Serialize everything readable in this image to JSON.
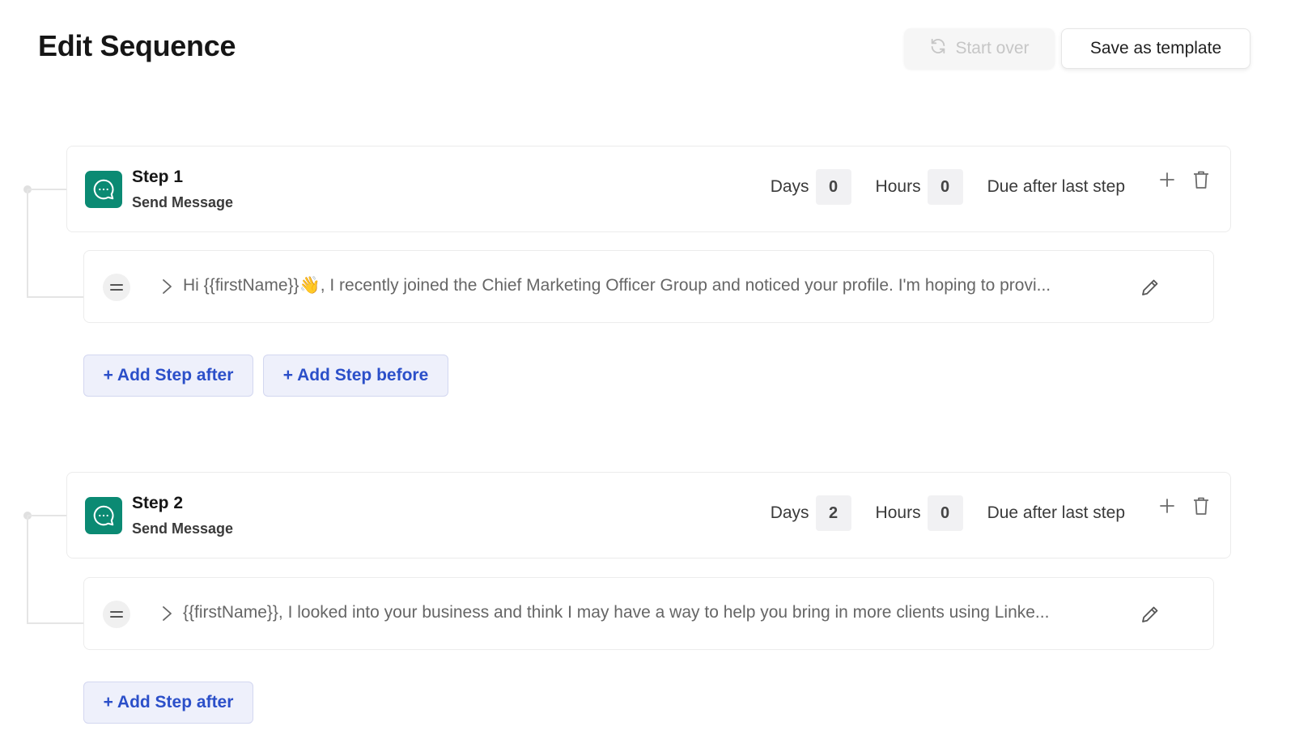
{
  "header": {
    "title": "Edit Sequence",
    "start_over_label": "Start over",
    "save_template_label": "Save as template"
  },
  "steps": [
    {
      "title": "Step 1",
      "subtitle": "Send Message",
      "days_label": "Days",
      "days": "0",
      "hours_label": "Hours",
      "hours": "0",
      "due_label": "Due after last step",
      "message": "Hi {{firstName}}👋, I recently joined the Chief Marketing Officer Group and noticed your profile. I'm hoping to provi...",
      "add_after_label": "+ Add Step after",
      "add_before_label": "+ Add Step before"
    },
    {
      "title": "Step 2",
      "subtitle": "Send Message",
      "days_label": "Days",
      "days": "2",
      "hours_label": "Hours",
      "hours": "0",
      "due_label": "Due after last step",
      "message": "{{firstName}}, I looked into your business and think I may have a way to help you bring in more clients using Linke...",
      "add_after_label": "+ Add Step after"
    }
  ],
  "colors": {
    "step_icon_bg": "#0b8a73",
    "add_button_text": "#2b4fc9",
    "add_button_bg": "#eef0fb"
  },
  "icons": {
    "start_over": "refresh-icon",
    "step": "chat-bubble-icon",
    "add": "plus-icon",
    "delete": "trash-icon",
    "drag": "drag-handle-icon",
    "expand": "chevron-right-icon",
    "edit": "pencil-icon"
  }
}
